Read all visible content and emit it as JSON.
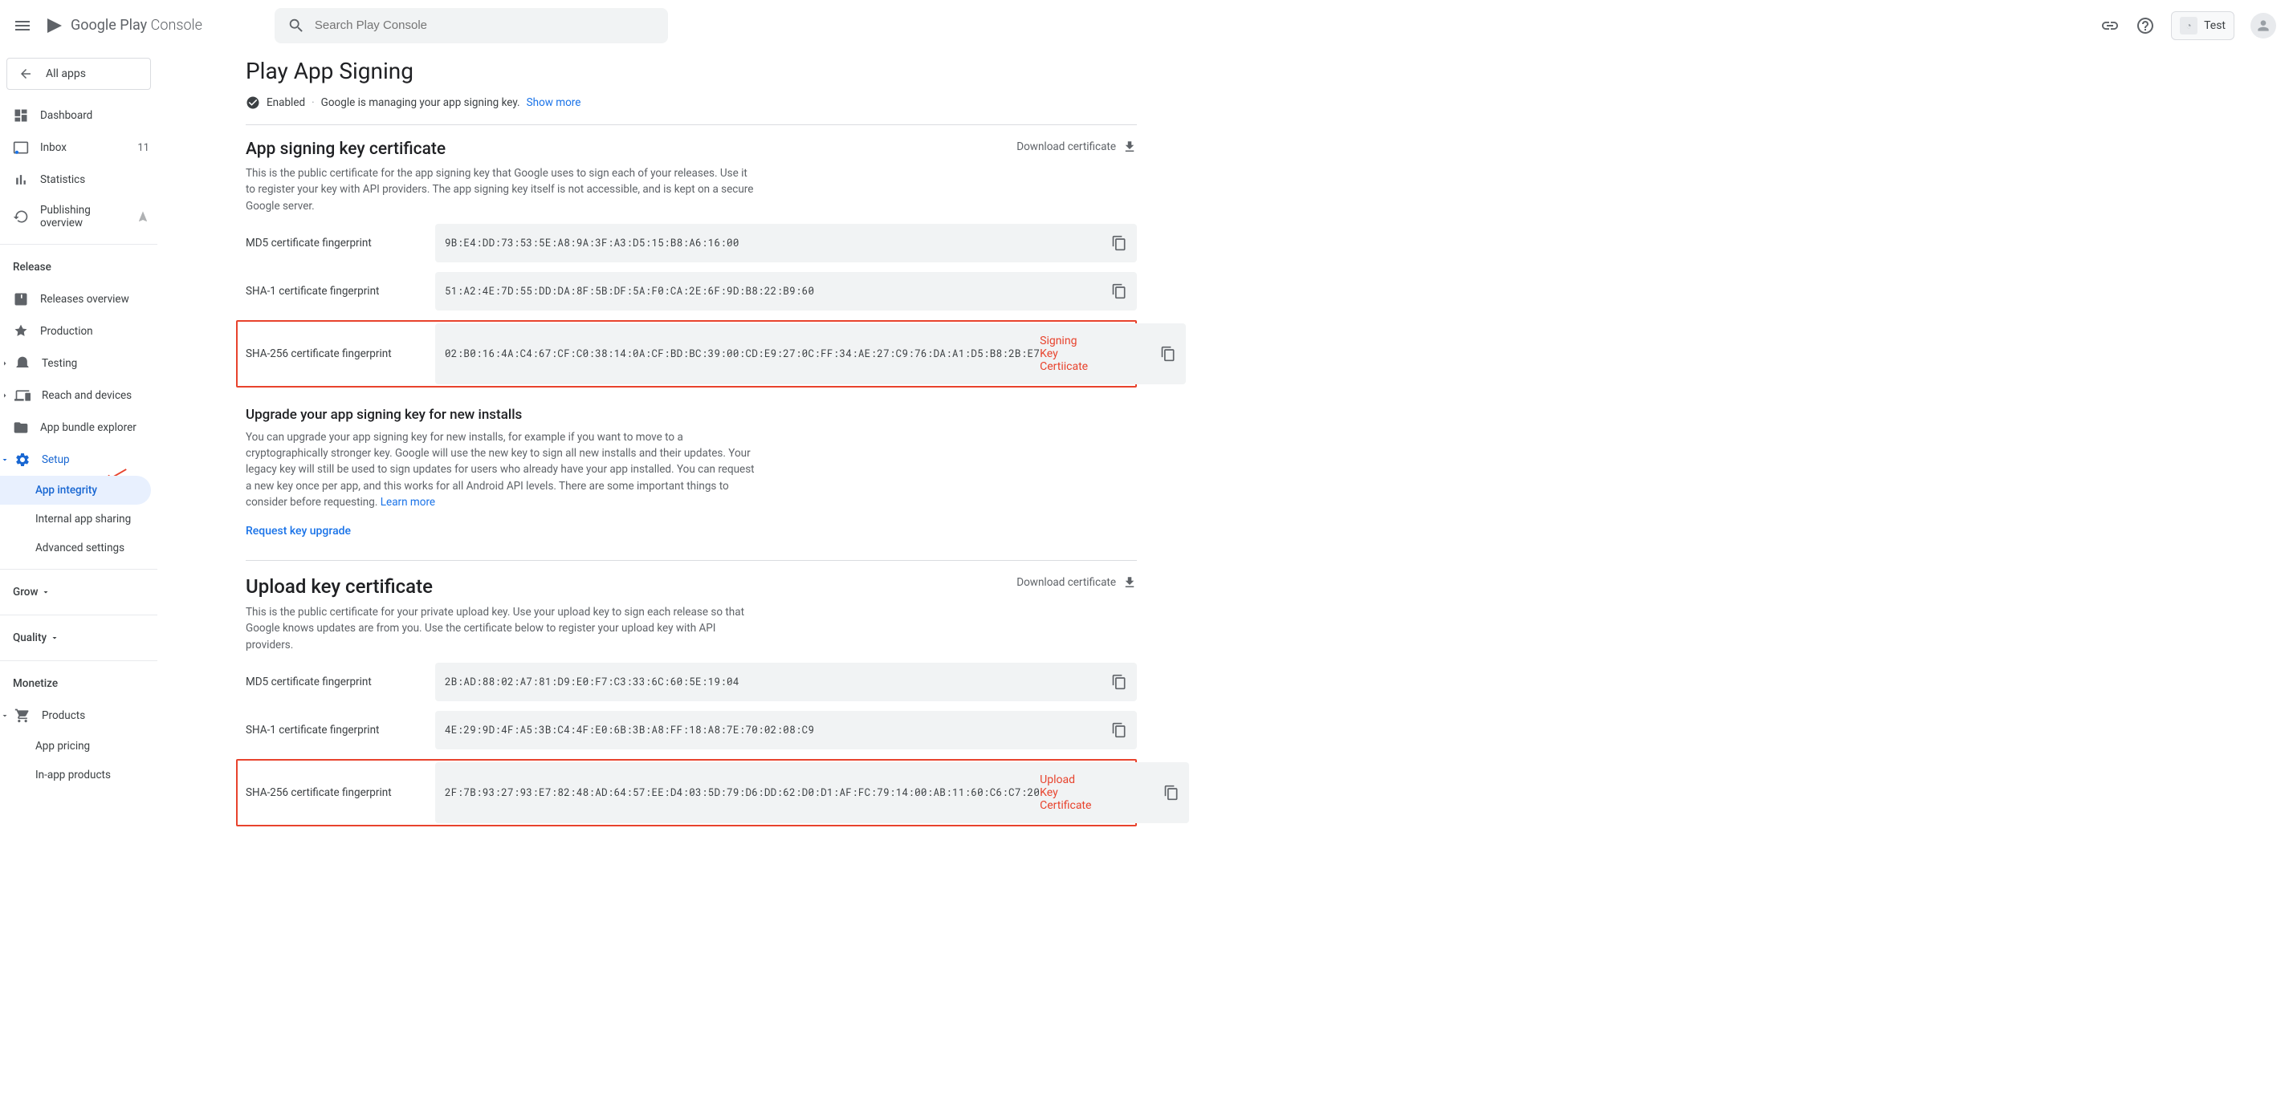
{
  "header": {
    "logo_prefix": "Google Play",
    "logo_suffix": "Console",
    "search_placeholder": "Search Play Console",
    "app_name": "Test"
  },
  "sidebar": {
    "back": "All apps",
    "items": [
      {
        "label": "Dashboard"
      },
      {
        "label": "Inbox",
        "badge": "11"
      },
      {
        "label": "Statistics"
      },
      {
        "label": "Publishing overview"
      }
    ],
    "release_label": "Release",
    "release_items": [
      {
        "label": "Releases overview"
      },
      {
        "label": "Production"
      },
      {
        "label": "Testing"
      },
      {
        "label": "Reach and devices"
      },
      {
        "label": "App bundle explorer"
      },
      {
        "label": "Setup"
      }
    ],
    "setup_sub": [
      {
        "label": "App integrity"
      },
      {
        "label": "Internal app sharing"
      },
      {
        "label": "Advanced settings"
      }
    ],
    "grow_label": "Grow",
    "quality_label": "Quality",
    "monetize_label": "Monetize",
    "monetize_items": [
      {
        "label": "Products"
      }
    ],
    "products_sub": [
      {
        "label": "App pricing"
      },
      {
        "label": "In-app products"
      }
    ]
  },
  "page": {
    "title": "Play App Signing",
    "status_enabled": "Enabled",
    "status_desc": "Google is managing your app signing key.",
    "show_more": "Show more",
    "download_cert": "Download certificate",
    "signing": {
      "title": "App signing key certificate",
      "desc": "This is the public certificate for the app signing key that Google uses to sign each of your releases. Use it to register your key with API providers. The app signing key itself is not accessible, and is kept on a secure Google server.",
      "md5_label": "MD5 certificate fingerprint",
      "md5_value": "9B:E4:DD:73:53:5E:A8:9A:3F:A3:D5:15:B8:A6:16:00",
      "sha1_label": "SHA-1 certificate fingerprint",
      "sha1_value": "51:A2:4E:7D:55:DD:DA:8F:5B:DF:5A:F0:CA:2E:6F:9D:B8:22:B9:60",
      "sha256_label": "SHA-256 certificate fingerprint",
      "sha256_value": "02:B0:16:4A:C4:67:CF:C0:38:14:0A:CF:BD:BC:39:00:CD:E9:27:0C:FF:34:AE:27:C9:76:DA:A1:D5:B8:2B:E7",
      "annotation": "Signing Key Certiicate"
    },
    "upgrade": {
      "title": "Upgrade your app signing key for new installs",
      "desc": "You can upgrade your app signing key for new installs, for example if you want to move to a cryptographically stronger key. Google will use the new key to sign all new installs and their updates. Your legacy key will still be used to sign updates for users who already have your app installed. You can request a new key once per app, and this works for all Android API levels. There are some important things to consider before requesting.",
      "learn_more": "Learn more",
      "request": "Request key upgrade"
    },
    "upload": {
      "title": "Upload key certificate",
      "desc": "This is the public certificate for your private upload key. Use your upload key to sign each release so that Google knows updates are from you. Use the certificate below to register your upload key with API providers.",
      "md5_label": "MD5 certificate fingerprint",
      "md5_value": "2B:AD:88:02:A7:81:D9:E0:F7:C3:33:6C:60:5E:19:04",
      "sha1_label": "SHA-1 certificate fingerprint",
      "sha1_value": "4E:29:9D:4F:A5:3B:C4:4F:E0:6B:3B:A8:FF:18:A8:7E:70:02:08:C9",
      "sha256_label": "SHA-256 certificate fingerprint",
      "sha256_value": "2F:7B:93:27:93:E7:82:48:AD:64:57:EE:D4:03:5D:79:D6:DD:62:D0:D1:AF:FC:79:14:00:AB:11:60:C6:C7:20",
      "annotation": "Upload Key Certificate"
    }
  }
}
